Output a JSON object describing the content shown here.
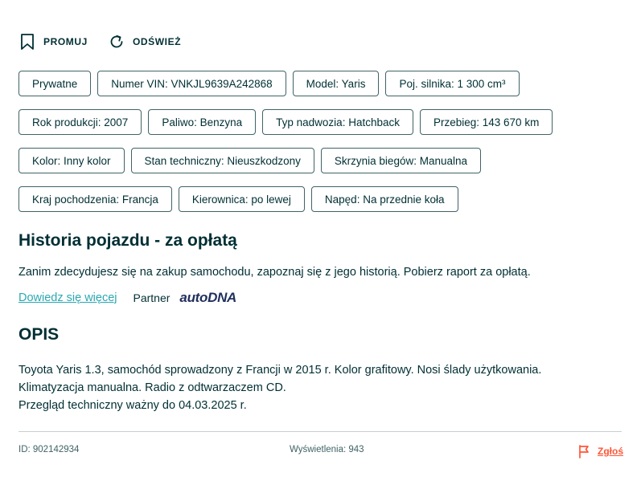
{
  "actions": {
    "promote_label": "PROMUJ",
    "refresh_label": "ODŚWIEŻ"
  },
  "params": [
    [
      "Prywatne",
      "Numer VIN: VNKJL9639A242868",
      "Model: Yaris",
      "Poj. silnika: 1 300 cm³"
    ],
    [
      "Rok produkcji: 2007",
      "Paliwo: Benzyna",
      "Typ nadwozia: Hatchback",
      "Przebieg: 143 670 km"
    ],
    [
      "Kolor: Inny kolor",
      "Stan techniczny: Nieuszkodzony",
      "Skrzynia biegów: Manualna"
    ],
    [
      "Kraj pochodzenia: Francja",
      "Kierownica: po lewej",
      "Napęd: Na przednie koła"
    ]
  ],
  "history": {
    "title": "Historia pojazdu - za opłatą",
    "text": "Zanim zdecydujesz się na zakup samochodu, zapoznaj się z jego historią. Pobierz raport za opłatą.",
    "learn_more": "Dowiedz się więcej",
    "partner_label": "Partner",
    "partner_name": "autoDNA"
  },
  "description": {
    "title": "OPIS",
    "lines": [
      "Toyota Yaris 1.3, samochód sprowadzony z Francji w 2015 r. Kolor grafitowy. Nosi ślady użytkowania.",
      "Klimatyzacja manualna. Radio z odtwarzaczem CD.",
      "Przegląd techniczny ważny do 04.03.2025 r."
    ]
  },
  "footer": {
    "id": "ID: 902142934",
    "views": "Wyświetlenia: 943",
    "report_label": "Zgłoś"
  },
  "colors": {
    "text": "#002f34",
    "link": "#2aa8b3",
    "report": "#ff5636",
    "chip_border": "#406367"
  },
  "icons": {
    "promote": "bookmark-icon",
    "refresh": "refresh-icon",
    "report": "flag-icon"
  }
}
